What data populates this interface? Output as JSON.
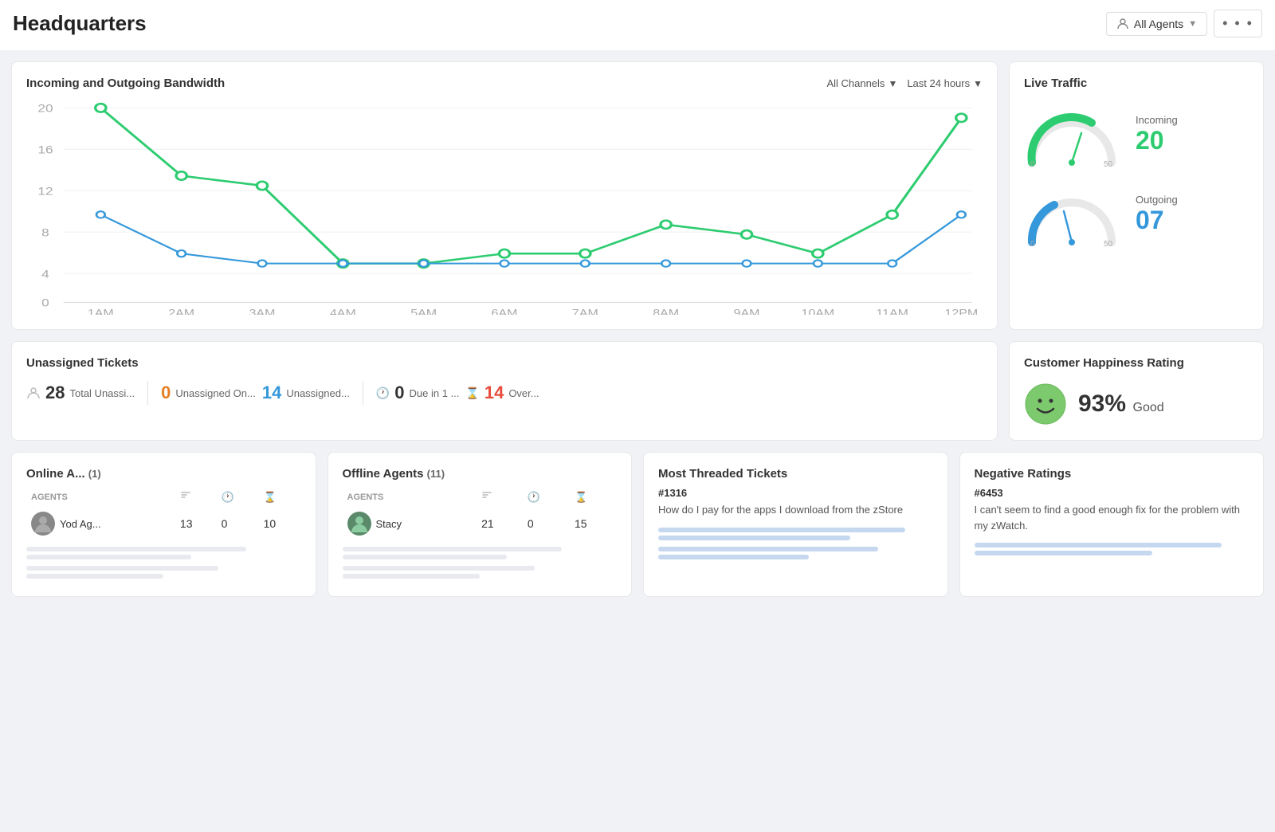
{
  "header": {
    "title": "Headquarters",
    "agents_btn": "All Agents",
    "more_btn": "..."
  },
  "bandwidth": {
    "title": "Incoming and Outgoing Bandwidth",
    "filter_channels": "All Channels",
    "filter_time": "Last 24 hours",
    "x_labels": [
      "1AM",
      "2AM",
      "3AM",
      "4AM",
      "5AM",
      "6AM",
      "7AM",
      "8AM",
      "9AM",
      "10AM",
      "11AM",
      "12PM"
    ],
    "y_labels": [
      "0",
      "4",
      "8",
      "12",
      "16",
      "20"
    ],
    "green_line": [
      20,
      13,
      12,
      4,
      4,
      5,
      5,
      8,
      7,
      5,
      9,
      19
    ],
    "blue_line": [
      9,
      5,
      4,
      4,
      4,
      4,
      4,
      4,
      4,
      4,
      4,
      9
    ]
  },
  "live_traffic": {
    "title": "Live Traffic",
    "incoming_label": "Incoming",
    "incoming_value": "20",
    "outgoing_label": "Outgoing",
    "outgoing_value": "07",
    "gauge_min": "0",
    "gauge_max": "50"
  },
  "unassigned_tickets": {
    "title": "Unassigned Tickets",
    "total_count": "28",
    "total_label": "Total Unassi...",
    "unassigned_on_count": "0",
    "unassigned_on_label": "Unassigned On...",
    "unassigned_count": "14",
    "unassigned_label": "Unassigned...",
    "due_count": "0",
    "due_label": "Due in 1 ...",
    "over_count": "14",
    "over_label": "Over..."
  },
  "happiness": {
    "title": "Customer Happiness Rating",
    "percentage": "93%",
    "label": "Good"
  },
  "online_agents": {
    "title": "Online A...",
    "count": "(1)",
    "columns": [
      "AGENTS",
      "",
      "",
      ""
    ],
    "rows": [
      {
        "name": "Yod Ag...",
        "col1": "13",
        "col2": "0",
        "col3": "10"
      }
    ]
  },
  "offline_agents": {
    "title": "Offline Agents",
    "count": "(11)",
    "rows": [
      {
        "name": "Stacy",
        "col1": "21",
        "col2": "0",
        "col3": "15"
      }
    ]
  },
  "threaded_tickets": {
    "title": "Most Threaded Tickets",
    "ticket_id": "#1316",
    "ticket_desc": "How do I pay for the apps I download from the zStore"
  },
  "negative_ratings": {
    "title": "Negative Ratings",
    "ticket_id": "#6453",
    "ticket_desc": "I can't seem to find a good enough fix for the problem with my zWatch."
  }
}
